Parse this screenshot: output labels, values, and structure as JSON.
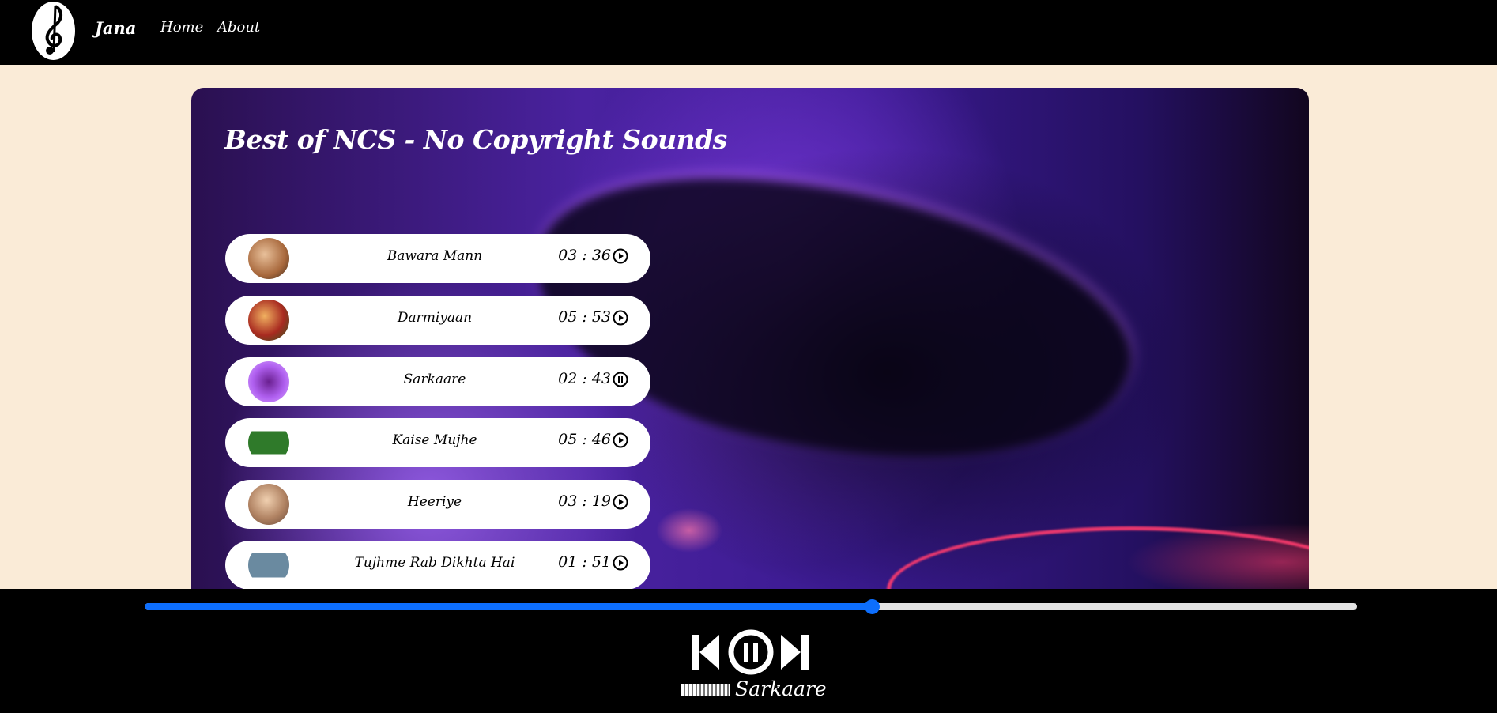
{
  "nav": {
    "logo_icon": "music-note-logo-icon",
    "brand": "Jana",
    "links": [
      {
        "label": "Home"
      },
      {
        "label": "About"
      }
    ]
  },
  "playlist": {
    "title": "Best of NCS - No Copyright Sounds",
    "songs": [
      {
        "name": "Bawara Mann",
        "duration": "03 : 36",
        "state": "play",
        "thumb_color": "#a8683c"
      },
      {
        "name": "Darmiyaan",
        "duration": "05 : 53",
        "state": "play",
        "thumb_color": "#a82a20"
      },
      {
        "name": "Sarkaare",
        "duration": "02 : 43",
        "state": "pause",
        "thumb_color": "#9a3fd0"
      },
      {
        "name": "Kaise Mujhe",
        "duration": "05 : 46",
        "state": "play",
        "thumb_color": "#2f7a2a"
      },
      {
        "name": "Heeriye",
        "duration": "03 : 19",
        "state": "play",
        "thumb_color": "#b08262"
      },
      {
        "name": "Tujhme Rab Dikhta Hai",
        "duration": "01 : 51",
        "state": "play",
        "thumb_color": "#6a8aa0"
      }
    ]
  },
  "player": {
    "progress": 0.6,
    "accent": "#0d6efd",
    "now_playing": "Sarkaare",
    "controls": [
      "previous-icon",
      "pause-icon",
      "next-icon"
    ]
  }
}
